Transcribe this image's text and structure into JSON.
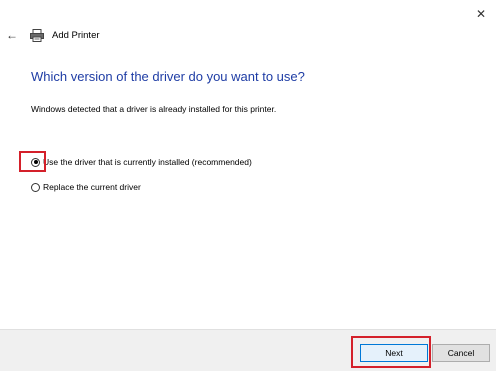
{
  "window": {
    "close_glyph": "✕"
  },
  "header": {
    "back_glyph": "←",
    "title": "Add Printer"
  },
  "main": {
    "heading": "Which version of the driver do you want to use?",
    "description": "Windows detected that a driver is already installed for this printer.",
    "options": [
      {
        "label": "Use the driver that is currently installed (recommended)",
        "selected": true
      },
      {
        "label": "Replace the current driver",
        "selected": false
      }
    ]
  },
  "footer": {
    "next_label": "Next",
    "cancel_label": "Cancel"
  },
  "colors": {
    "heading": "#1f3da5",
    "highlight": "#d4202a",
    "footer_bg": "#f0f0f0",
    "primary_border": "#0078d7"
  },
  "icons": {
    "back": "back-arrow-icon",
    "printer": "printer-icon",
    "close": "close-icon"
  }
}
